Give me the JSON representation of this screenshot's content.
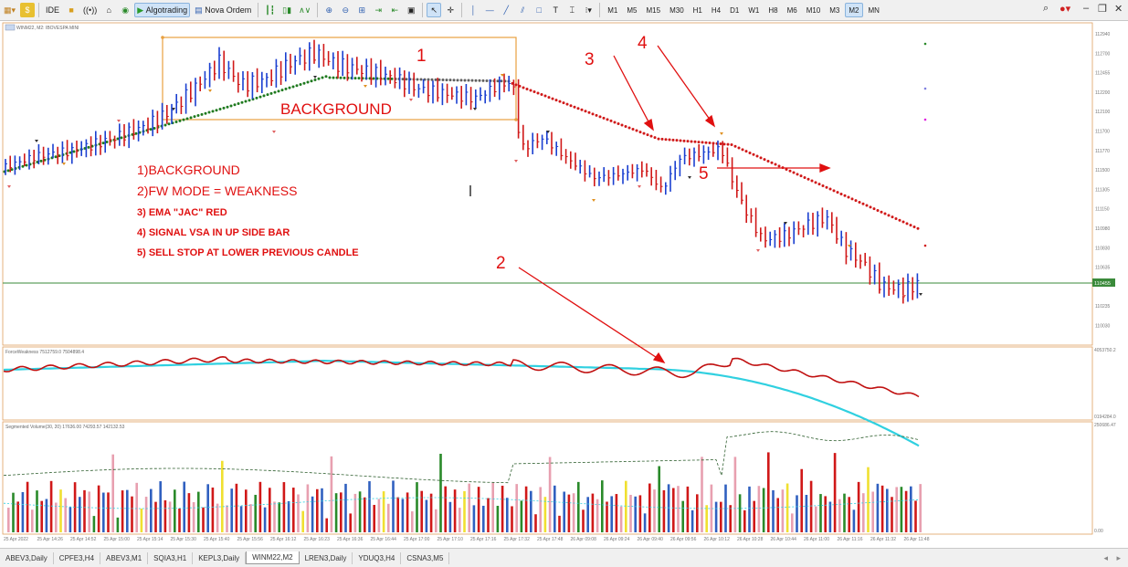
{
  "toolbar": {
    "ide_label": "IDE",
    "algotrading_label": "Algotrading",
    "nova_ordem_label": "Nova Ordem",
    "timeframes": [
      "M1",
      "M5",
      "M15",
      "M30",
      "H1",
      "H4",
      "D1",
      "W1",
      "H8",
      "M6",
      "M10",
      "M3",
      "M2",
      "MN"
    ],
    "selected_timeframe": "M2"
  },
  "chart": {
    "symbol_header": "WINM22, M2:  IBOVESPA MINI",
    "current_price": "110455",
    "price_ticks": [
      "112940",
      "112700",
      "112455",
      "112200",
      "112100",
      "111700",
      "111770",
      "111500",
      "111305",
      "111150",
      "110980",
      "110830",
      "110635",
      "110455",
      "110235",
      "110030"
    ],
    "time_ticks": [
      "25 Apr 2022",
      "25 Apr 14:26",
      "25 Apr 14:52",
      "25 Apr 15:00",
      "25 Apr 15:14",
      "25 Apr 15:30",
      "25 Apr 15:40",
      "25 Apr 15:56",
      "25 Apr 16:12",
      "25 Apr 16:23",
      "25 Apr 16:36",
      "25 Apr 16:44",
      "25 Apr 17:00",
      "25 Apr 17:10",
      "25 Apr 17:16",
      "25 Apr 17:32",
      "25 Apr 17:48",
      "26 Apr 09:08",
      "26 Apr 09:24",
      "26 Apr 09:40",
      "26 Apr 09:56",
      "26 Apr 10:12",
      "26 Apr 10:28",
      "26 Apr 10:44",
      "26 Apr 11:00",
      "26 Apr 11:16",
      "26 Apr 11:32",
      "26 Apr 11:48"
    ],
    "fw_label": "ForceWeakness  7512759.0  7504898.4",
    "fw_right_value": "4053750.2",
    "fw_right_value2": "0194284.0",
    "vol_label": "Segmented Volume(30, 20)  17636.00  74293.57  142132.53",
    "vol_right_value": "250686.47",
    "vol_right_zero": "0.00",
    "background_label": "BACKGROUND",
    "box_number": "1",
    "arrow_numbers": {
      "two": "2",
      "three": "3",
      "four": "4",
      "five": "5"
    },
    "notes": [
      "1)BACKGROUND",
      "2)FW  MODE =  WEAKNESS",
      "3)  EMA      \"JAC\" RED",
      "4)  SIGNAL VSA IN UP SIDE BAR",
      "5)  SELL STOP AT LOWER PREVIOUS CANDLE"
    ]
  },
  "colors": {
    "bull": "#1a3fd0",
    "bear": "#d01818",
    "ema_green": "#1f7a1f",
    "ema_red": "#d01818",
    "annotation": "#e01010",
    "fw_line": "#c01010",
    "fw_signal": "#30d0e0",
    "box": "#e8a040"
  },
  "bottom_tabs": [
    "ABEV3,Daily",
    "CPFE3,H4",
    "ABEV3,M1",
    "SQIA3,H1",
    "KEPL3,Daily",
    "WINM22,M2",
    "LREN3,Daily",
    "YDUQ3,H4",
    "CSNA3,M5"
  ],
  "active_tab": "WINM22,M2"
}
